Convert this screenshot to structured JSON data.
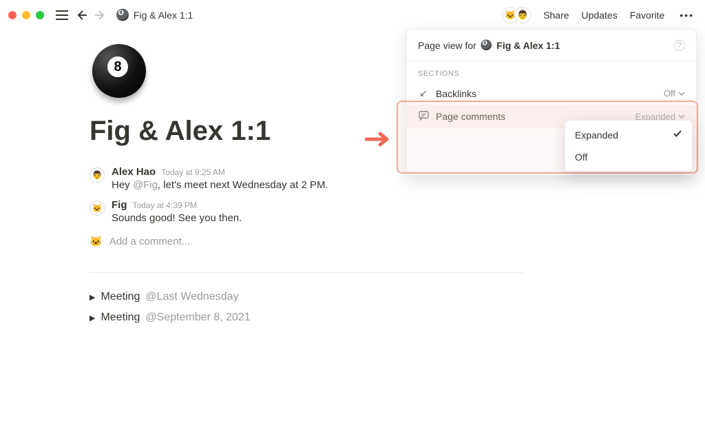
{
  "breadcrumb": {
    "icon": "🎱",
    "title": "Fig & Alex 1:1"
  },
  "header": {
    "share": "Share",
    "updates": "Updates",
    "favorite": "Favorite"
  },
  "page": {
    "title": "Fig & Alex 1:1",
    "icon": "🎱"
  },
  "comments": [
    {
      "avatar": "👨",
      "author": "Alex Hao",
      "time": "Today at 9:25 AM",
      "text_prefix": "Hey ",
      "mention": "@Fig",
      "text_suffix": ", let's meet next Wednesday at 2 PM."
    },
    {
      "avatar": "🐱",
      "author": "Fig",
      "time": "Today at 4:39 PM",
      "text_prefix": "Sounds good! See you then.",
      "mention": "",
      "text_suffix": ""
    }
  ],
  "add_comment_placeholder": "Add a comment...",
  "toggles": [
    {
      "label": "Meeting",
      "date": "@Last Wednesday"
    },
    {
      "label": "Meeting",
      "date": "@September 8, 2021"
    }
  ],
  "panel": {
    "heading_prefix": "Page view for",
    "heading_title": "Fig & Alex 1:1",
    "section_label": "SECTIONS",
    "rows": [
      {
        "icon": "↙",
        "label": "Backlinks",
        "value": "Off"
      },
      {
        "icon": "💬",
        "label": "Page comments",
        "value": "Expanded"
      }
    ]
  },
  "submenu": {
    "items": [
      {
        "label": "Expanded",
        "checked": true
      },
      {
        "label": "Off",
        "checked": false
      }
    ]
  }
}
